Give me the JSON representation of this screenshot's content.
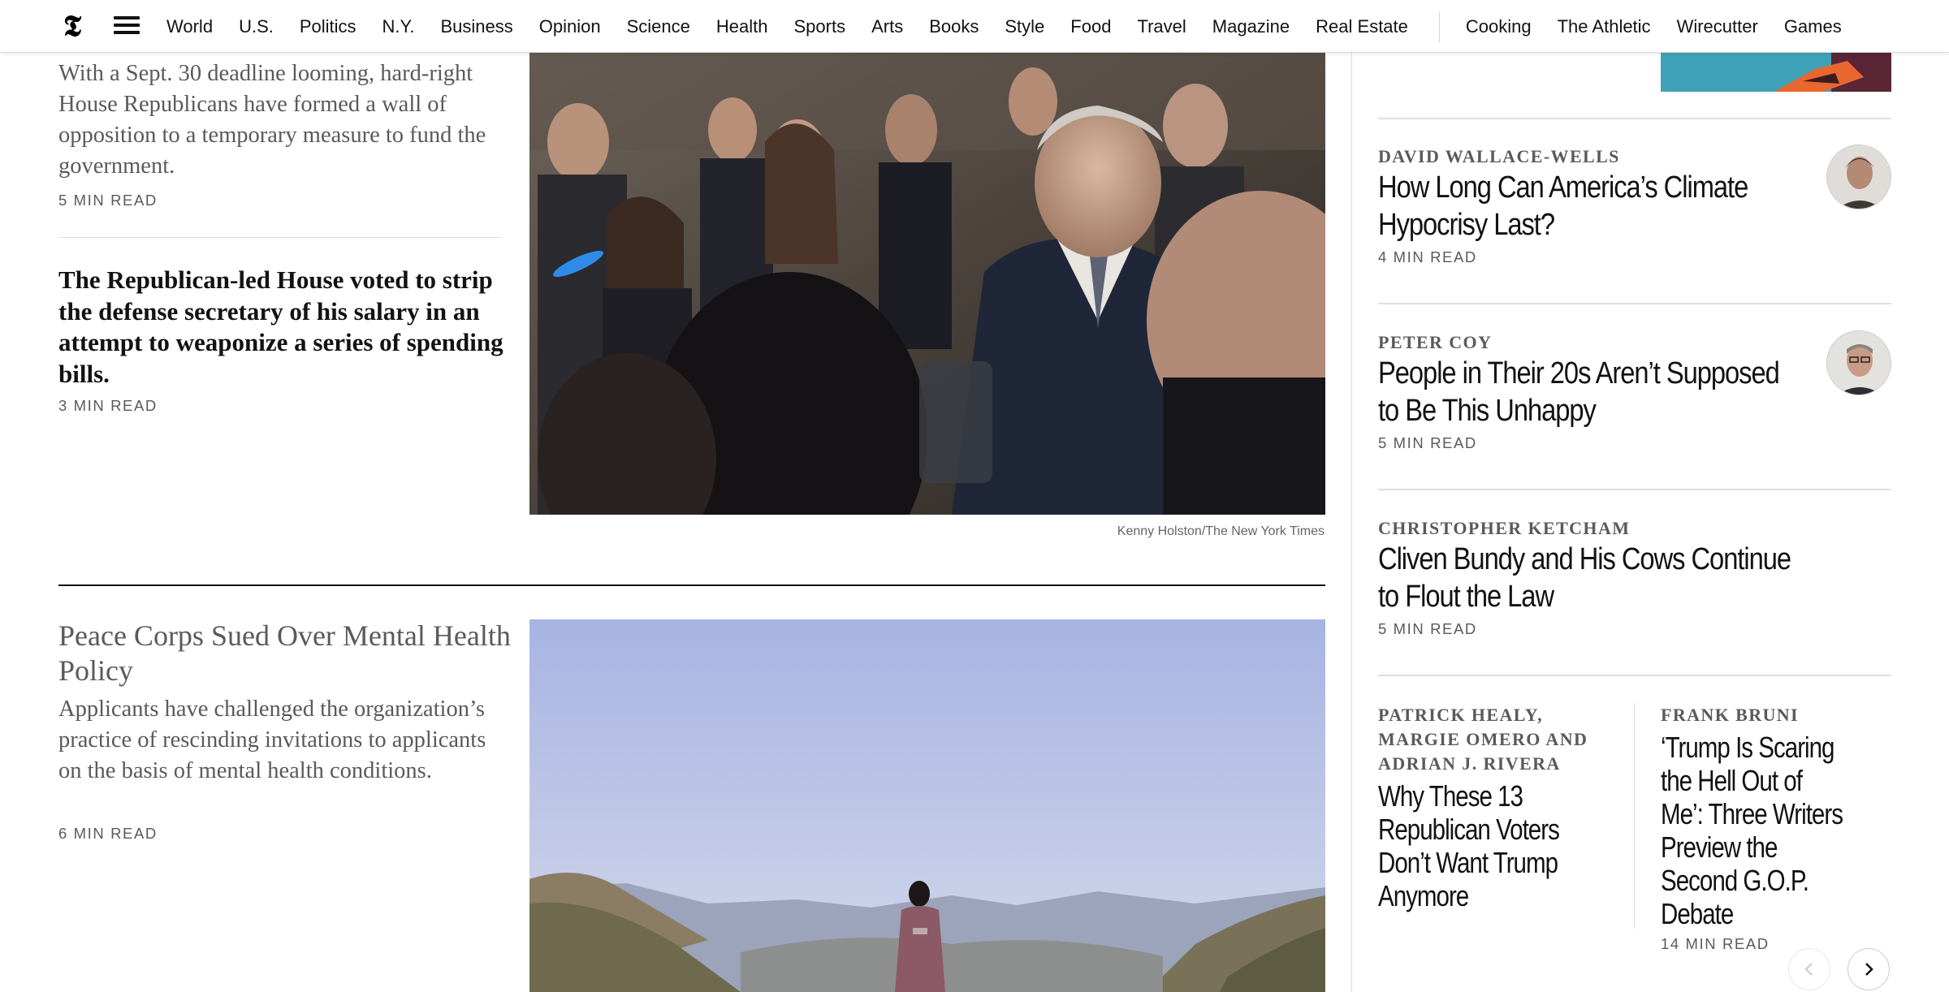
{
  "nav": {
    "logo": "𝕿",
    "items": [
      "World",
      "U.S.",
      "Politics",
      "N.Y.",
      "Business",
      "Opinion",
      "Science",
      "Health",
      "Sports",
      "Arts",
      "Books",
      "Style",
      "Food",
      "Travel",
      "Magazine",
      "Real Estate"
    ],
    "products": [
      "Cooking",
      "The Athletic",
      "Wirecutter",
      "Games"
    ]
  },
  "main": {
    "story1": {
      "summary": "With a Sept. 30 deadline looming, hard-right House Republicans have formed a wall of opposition to a temporary measure to fund the government.",
      "read_time": "5 MIN READ"
    },
    "story2": {
      "headline": "The Republican-led House voted to strip the defense secretary of his salary in an attempt to weaponize a series of spending bills.",
      "read_time": "3 MIN READ"
    },
    "photo1": {
      "caption": "Kenny Holston/The New York Times"
    },
    "story3": {
      "headline": "Peace Corps Sued Over Mental Health Policy",
      "summary": "Applicants have challenged the organization’s practice of rescinding invitations to applicants on the basis of mental health conditions.",
      "read_time": "6 MIN READ"
    }
  },
  "opinion": {
    "items": [
      {
        "byline": "DAVID WALLACE-WELLS",
        "title": "How Long Can America’s Climate Hypocrisy Last?",
        "read_time": "4 MIN READ"
      },
      {
        "byline": "PETER COY",
        "title": "People in Their 20s Aren’t Supposed to Be This Unhappy",
        "read_time": "5 MIN READ"
      },
      {
        "byline": "CHRISTOPHER KETCHAM",
        "title": "Cliven Bundy and His Cows Continue to Flout the Law",
        "read_time": "5 MIN READ"
      }
    ],
    "duo": [
      {
        "byline": "PATRICK HEALY, MARGIE OMERO AND ADRIAN J. RIVERA",
        "title": "Why These 13 Republican Voters Don’t Want Trump Anymore"
      },
      {
        "byline": "FRANK BRUNI",
        "title": "‘Trump Is Scaring the Hell Out of Me’: Three Writers Preview the Second G.O.P. Debate",
        "read_time": "14 MIN READ"
      }
    ]
  }
}
